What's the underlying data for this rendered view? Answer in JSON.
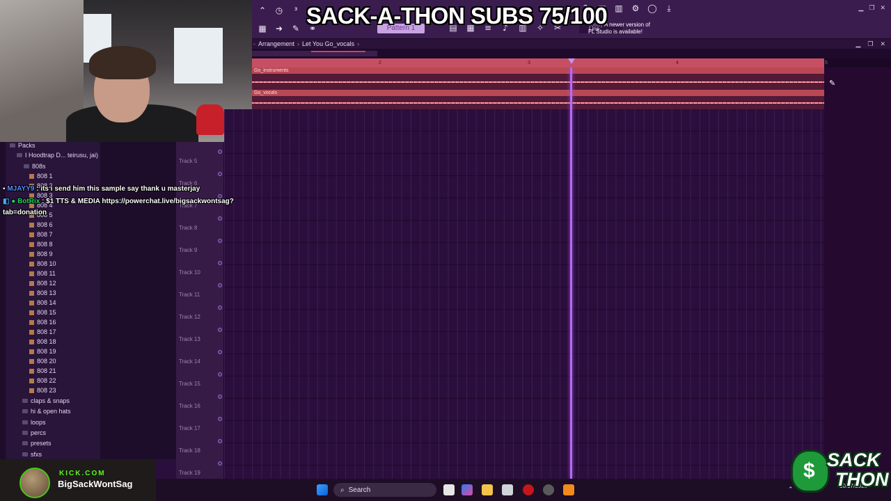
{
  "overlay": {
    "title": "SACK-A-THON SUBS 75/100"
  },
  "toolbar": {
    "line_mode": "Line",
    "pattern": "Pattern 1",
    "news_date": "Today",
    "news_line1": "A newer version of",
    "news_line2": "FL Studio is available!"
  },
  "playlist": {
    "breadcrumb_1": "Arrangement",
    "breadcrumb_2": "Let You Go_vocals",
    "ruler_marks": [
      "2",
      "3",
      "4",
      "5"
    ],
    "clips": [
      {
        "label": "Go_instruments"
      },
      {
        "label": "Go_vocals"
      }
    ],
    "tracks": [
      "Track 5",
      "Track 6",
      "Track 7",
      "Track 8",
      "Track 9",
      "Track 10",
      "Track 11",
      "Track 12",
      "Track 13",
      "Track 14",
      "Track 15",
      "Track 16",
      "Track 17",
      "Track 18",
      "Track 19"
    ]
  },
  "browser": {
    "root": "Packs",
    "pack": "I Hoodtrap D... teirusu, jai)",
    "folder": "808s",
    "files": [
      "808 1",
      "808 2",
      "808 3",
      "808 4",
      "808 5",
      "808 6",
      "808 7",
      "808 8",
      "808 9",
      "808 10",
      "808 11",
      "808 12",
      "808 13",
      "808 14",
      "808 15",
      "808 16",
      "808 17",
      "808 18",
      "808 19",
      "808 20",
      "808 21",
      "808 22",
      "808 23"
    ],
    "folders_after": [
      "claps & snaps",
      "hi & open hats",
      "loops",
      "percs",
      "presets",
      "sfxs"
    ]
  },
  "chat": [
    {
      "user": "MJAYY9",
      "message": ": its i send him this sample say thank u masterjay"
    },
    {
      "user": "BotRix",
      "message": ": $1 TTS & MEDIA https://powerchat.live/bigsackwontsag?",
      "continuation": "tab=donation"
    }
  ],
  "kick": {
    "logo": "KICK.COM",
    "channel": "BigSackWontSag"
  },
  "taskbar": {
    "search_label": "Search",
    "date": "10/17/2025"
  },
  "branding": {
    "line1": "SACK",
    "line2": "THON"
  }
}
